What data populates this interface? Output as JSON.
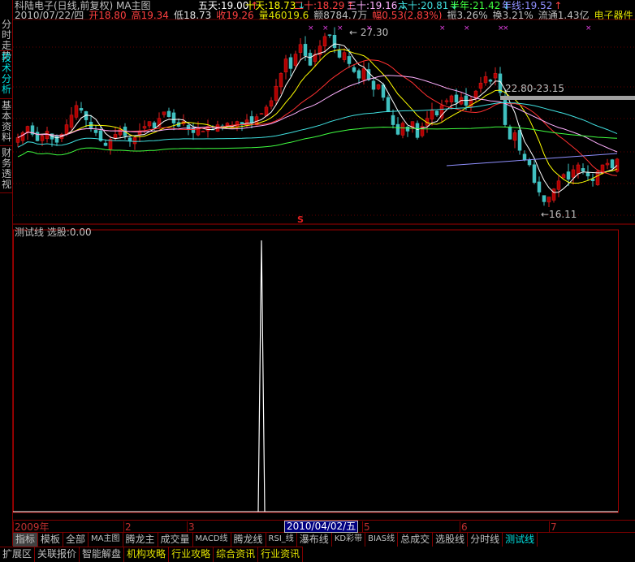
{
  "header": {
    "title": "科陆电子(日线,前复权) MA主图",
    "ma": [
      {
        "label": "五天:19.00",
        "arrow": "↑",
        "color": "#ffffff",
        "acolor": "#ff4040"
      },
      {
        "label": "十天:18.73",
        "arrow": "↓",
        "color": "#ffff00",
        "acolor": "#40e0e0"
      },
      {
        "label": "二十:18.29",
        "arrow": "↑",
        "color": "#ff4040",
        "acolor": "#ff4040"
      },
      {
        "label": "三十:19.16",
        "arrow": "↓",
        "color": "#ffb0ff",
        "acolor": "#40e0e0"
      },
      {
        "label": "六十:20.81",
        "arrow": "↓",
        "color": "#40e0e0",
        "acolor": "#40e0e0"
      },
      {
        "label": "半年:21.42",
        "arrow": "↓",
        "color": "#40ff40",
        "acolor": "#40e0e0"
      },
      {
        "label": "年线:19.52",
        "arrow": "↑",
        "color": "#9090ff",
        "acolor": "#ff4040"
      }
    ],
    "date": "2010/07/22/四",
    "quote": [
      {
        "t": "开18.80",
        "c": "#ff4040"
      },
      {
        "t": "高19.34",
        "c": "#ff4040"
      },
      {
        "t": "低18.73",
        "c": "#e0e0e0"
      },
      {
        "t": "收19.26",
        "c": "#ff4040"
      },
      {
        "t": "量46019.6",
        "c": "#e0e000"
      },
      {
        "t": "额8784.7万",
        "c": "#c0c0c0"
      },
      {
        "t": "幅0.53(2.83%)",
        "c": "#ff4040"
      },
      {
        "t": "振3.26%",
        "c": "#c0c0c0"
      },
      {
        "t": "换3.21%",
        "c": "#c0c0c0"
      },
      {
        "t": "流通1.43亿",
        "c": "#c0c0c0"
      },
      {
        "t": "电子器件",
        "c": "#e0e000"
      }
    ]
  },
  "left_tabs": [
    {
      "label": "分时走势"
    },
    {
      "label": "技术分析",
      "active": true
    },
    {
      "label": "基本资料"
    },
    {
      "label": "财务透视"
    }
  ],
  "annotations": {
    "high": "27.30",
    "low": "←16.11",
    "range": "22.80-23.15",
    "marker": "S"
  },
  "indicator": {
    "name": "测试线",
    "value": "选股:0.00",
    "spike_bar": 50
  },
  "price_data": {
    "closes": [
      20.6,
      20.9,
      21.3,
      20.8,
      20.4,
      20.7,
      21.0,
      20.5,
      20.3,
      20.8,
      21.4,
      22.0,
      22.6,
      22.3,
      21.7,
      21.2,
      20.9,
      20.4,
      20.1,
      20.5,
      20.8,
      21.1,
      20.7,
      20.4,
      20.6,
      21.0,
      21.3,
      21.6,
      21.2,
      21.8,
      22.2,
      21.9,
      21.5,
      21.3,
      21.6,
      21.1,
      20.9,
      21.2,
      21.0,
      21.3,
      21.1,
      21.4,
      21.2,
      21.5,
      21.3,
      21.6,
      21.4,
      21.7,
      21.5,
      21.9,
      22.1,
      22.5,
      22.9,
      23.8,
      24.6,
      25.5,
      24.9,
      25.8,
      26.4,
      25.7,
      25.1,
      25.8,
      26.3,
      26.9,
      27.0,
      26.2,
      25.6,
      25.9,
      25.2,
      24.7,
      24.3,
      24.9,
      24.2,
      23.6,
      23.9,
      23.1,
      22.2,
      21.4,
      20.8,
      21.5,
      21.0,
      21.6,
      20.6,
      21.3,
      21.8,
      22.3,
      22.0,
      22.6,
      22.9,
      23.2,
      22.8,
      23.1,
      22.6,
      23.0,
      23.5,
      24.0,
      24.4,
      24.1,
      24.6,
      23.4,
      21.4,
      20.5,
      20.9,
      19.8,
      19.2,
      18.9,
      17.8,
      17.2,
      16.6,
      16.9,
      17.4,
      17.9,
      18.3,
      18.0,
      18.6,
      18.9,
      18.5,
      18.2,
      17.9,
      18.5,
      18.9,
      19.0,
      18.7,
      19.26
    ],
    "marker_bars": [
      60,
      63,
      66,
      72,
      87,
      92,
      99,
      100,
      117
    ]
  },
  "date_axis": {
    "labels": [
      "2009年",
      "2",
      "3",
      "5",
      "6",
      "7"
    ],
    "cursor": "2010/04/02/五"
  },
  "tabs": [
    "指标",
    "模板",
    "全部",
    "MA主图",
    "腾龙主",
    "成交量",
    "MACD线",
    "腾龙线",
    "RSI_线",
    "瀑布线",
    "KD彩带",
    "BIAS线",
    "总成交",
    "选股线",
    "分时线",
    "测试线"
  ],
  "bottom": [
    {
      "t": "扩展区",
      "y": false
    },
    {
      "t": "关联报价",
      "y": false
    },
    {
      "t": "智能解盘",
      "y": false
    },
    {
      "t": "机构攻略",
      "y": true
    },
    {
      "t": "行业攻略",
      "y": true
    },
    {
      "t": "综合资讯",
      "y": true
    },
    {
      "t": "行业资讯",
      "y": true
    }
  ]
}
